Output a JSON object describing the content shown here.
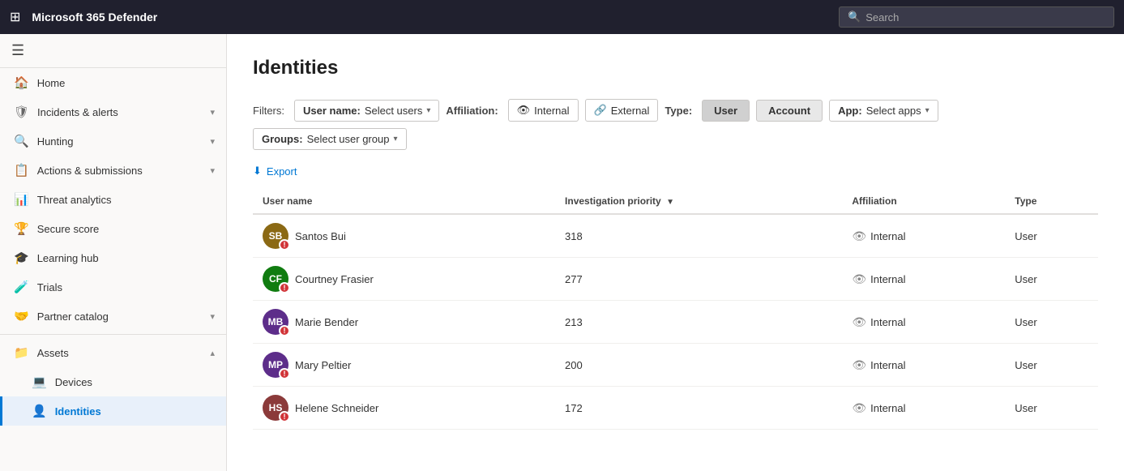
{
  "topbar": {
    "title": "Microsoft 365 Defender",
    "search_placeholder": "Search"
  },
  "sidebar": {
    "toggle_label": "☰",
    "items": [
      {
        "id": "home",
        "label": "Home",
        "icon": "🏠",
        "hasChevron": false,
        "active": false
      },
      {
        "id": "incidents",
        "label": "Incidents & alerts",
        "icon": "🛡",
        "hasChevron": true,
        "active": false
      },
      {
        "id": "hunting",
        "label": "Hunting",
        "icon": "🔍",
        "hasChevron": true,
        "active": false
      },
      {
        "id": "actions",
        "label": "Actions & submissions",
        "icon": "📋",
        "hasChevron": true,
        "active": false
      },
      {
        "id": "threat",
        "label": "Threat analytics",
        "icon": "📊",
        "hasChevron": false,
        "active": false
      },
      {
        "id": "secure",
        "label": "Secure score",
        "icon": "🏆",
        "hasChevron": false,
        "active": false
      },
      {
        "id": "learning",
        "label": "Learning hub",
        "icon": "🎓",
        "hasChevron": false,
        "active": false
      },
      {
        "id": "trials",
        "label": "Trials",
        "icon": "🧪",
        "hasChevron": false,
        "active": false
      },
      {
        "id": "partner",
        "label": "Partner catalog",
        "icon": "🤝",
        "hasChevron": true,
        "active": false
      },
      {
        "id": "assets",
        "label": "Assets",
        "icon": "📁",
        "hasChevron": true,
        "active": false,
        "expanded": true
      },
      {
        "id": "devices",
        "label": "Devices",
        "icon": "💻",
        "hasChevron": false,
        "active": false,
        "sub": true
      },
      {
        "id": "identities",
        "label": "Identities",
        "icon": "👤",
        "hasChevron": false,
        "active": true,
        "sub": true
      }
    ]
  },
  "page": {
    "title": "Identities",
    "filters_label": "Filters:",
    "username_label": "User name:",
    "username_placeholder": "Select users",
    "affiliation_label": "Affiliation:",
    "affiliation_internal": "Internal",
    "affiliation_external": "External",
    "type_label": "Type:",
    "type_user": "User",
    "type_account": "Account",
    "app_label": "App:",
    "app_placeholder": "Select apps",
    "groups_label": "Groups:",
    "groups_placeholder": "Select user group",
    "export_label": "Export"
  },
  "table": {
    "columns": [
      {
        "id": "username",
        "label": "User name"
      },
      {
        "id": "priority",
        "label": "Investigation priority",
        "sortable": true
      },
      {
        "id": "affiliation",
        "label": "Affiliation"
      },
      {
        "id": "type",
        "label": "Type"
      }
    ],
    "rows": [
      {
        "name": "Santos Bui",
        "initials": "SB",
        "avatar_color": "#8B4513",
        "priority": 318,
        "affiliation": "Internal",
        "type": "User",
        "has_photo": true,
        "photo_type": "photo"
      },
      {
        "name": "Courtney Frasier",
        "initials": "CF",
        "avatar_color": "#107C10",
        "priority": 277,
        "affiliation": "Internal",
        "type": "User",
        "has_photo": false
      },
      {
        "name": "Marie Bender",
        "initials": "MB",
        "avatar_color": "#5D2D8A",
        "priority": 213,
        "affiliation": "Internal",
        "type": "User",
        "has_photo": false
      },
      {
        "name": "Mary Peltier",
        "initials": "MP",
        "avatar_color": "#5D2D8A",
        "priority": 200,
        "affiliation": "Internal",
        "type": "User",
        "has_photo": false
      },
      {
        "name": "Helene Schneider",
        "initials": "HS",
        "avatar_color": "#8B3A3A",
        "priority": 172,
        "affiliation": "Internal",
        "type": "User",
        "has_photo": true,
        "photo_type": "photo2"
      }
    ]
  }
}
